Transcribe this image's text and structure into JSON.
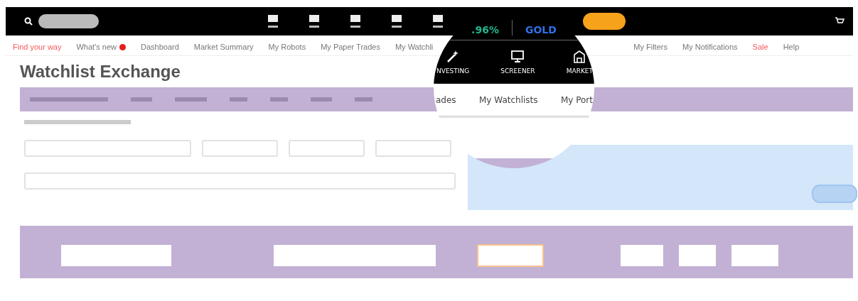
{
  "nav_links": [
    {
      "label": "Find your way",
      "kind": "accent",
      "badge": false
    },
    {
      "label": "What's new",
      "kind": "normal",
      "badge": true
    },
    {
      "label": "Dashboard",
      "kind": "normal",
      "badge": false
    },
    {
      "label": "Market Summary",
      "kind": "normal",
      "badge": false
    },
    {
      "label": "My Robots",
      "kind": "normal",
      "badge": false
    },
    {
      "label": "My Paper Trades",
      "kind": "normal",
      "badge": false
    },
    {
      "label": "My Watchli",
      "kind": "normal",
      "badge": false
    },
    {
      "label": "My Filters",
      "kind": "normal",
      "badge": false
    },
    {
      "label": "My Notifications",
      "kind": "normal",
      "badge": false
    },
    {
      "label": "Sale",
      "kind": "accent",
      "badge": false
    },
    {
      "label": "Help",
      "kind": "normal",
      "badge": false
    }
  ],
  "title": "Watchlist Exchange",
  "magnifier": {
    "ticker": [
      {
        "text": ".96%",
        "kind": "change"
      },
      {
        "text": "GOLD",
        "kind": "symbol"
      }
    ],
    "menu": [
      {
        "label": "NVESTING"
      },
      {
        "label": "SCREENER"
      },
      {
        "label": "MARKET"
      }
    ],
    "nav": [
      {
        "label": "ades"
      },
      {
        "label": "My Watchlists"
      },
      {
        "label": "My Port"
      }
    ]
  }
}
